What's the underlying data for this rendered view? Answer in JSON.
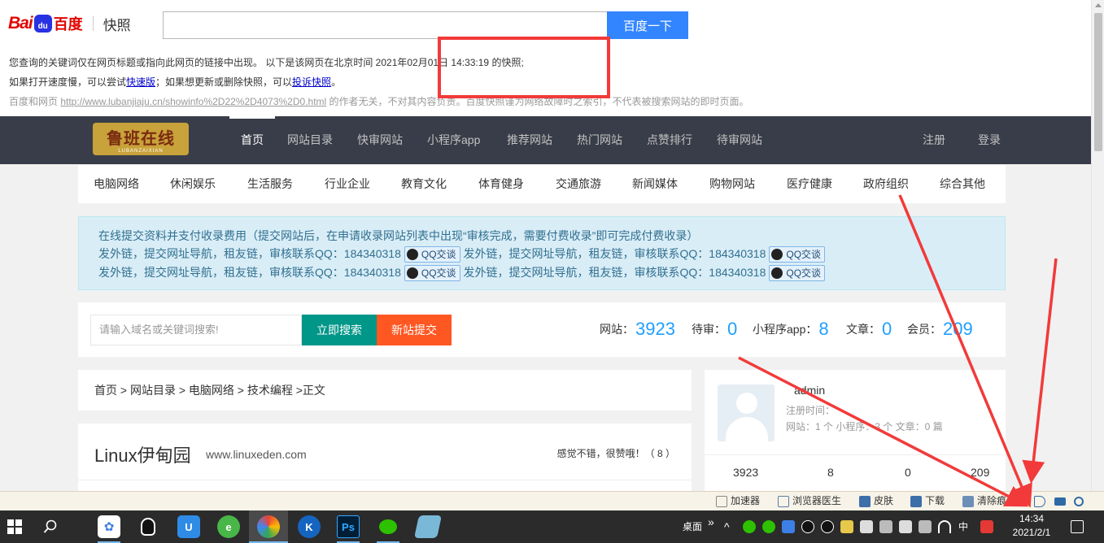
{
  "baidu": {
    "logo_bai": "Bai",
    "logo_du": "du",
    "logo_cn": "百度",
    "logo_kz": "快照",
    "search_button": "百度一下",
    "search_value": "",
    "line1": "您查询的关键词仅在网页标题或指向此网页的链接中出现。  以下是该网页在北京时间 2021年02月01日 14:33:19 的快照;",
    "line2_a": "如果打开速度慢，可以尝试",
    "line2_link1": "快速版",
    "line2_b": "；如果想更新或删除快照，可以",
    "line2_link2": "投诉快照",
    "line2_c": "。",
    "line3_a": "百度和网页 ",
    "line3_url": "http://www.lubanjiaju.cn/showinfo%2D22%2D4073%2D0.html",
    "line3_b": " 的作者无关，不对其内容负责。百度快照谨为网络故障时之索引，不代表被搜索网站的即时页面。"
  },
  "site": {
    "logo_text": "鲁班在线",
    "logo_sub": "LUBANZAIXIAN",
    "nav": [
      "首页",
      "网站目录",
      "快审网站",
      "小程序app",
      "推荐网站",
      "热门网站",
      "点赞排行",
      "待审网站"
    ],
    "nav_right": [
      "注册",
      "登录"
    ],
    "categories": [
      "电脑网络",
      "休闲娱乐",
      "生活服务",
      "行业企业",
      "教育文化",
      "体育健身",
      "交通旅游",
      "新闻媒体",
      "购物网站",
      "医疗健康",
      "政府组织",
      "综合其他"
    ],
    "notice": {
      "line1": "在线提交资料并支付收录费用（提交网站后，在申请收录网站列表中出现“审核完成，需要付费收录”即可完成付费收录）",
      "ad": "发外链，提交网址导航，租友链，审核联系QQ：184340318",
      "qq_button": "QQ交谈"
    },
    "search_placeholder": "请输入域名或关键词搜索!",
    "search_button": "立即搜索",
    "submit_button": "新站提交",
    "stats": [
      {
        "label": "网站：",
        "value": "3923"
      },
      {
        "label": "待审：",
        "value": "0"
      },
      {
        "label": "小程序app：",
        "value": "8"
      },
      {
        "label": "文章：",
        "value": "0"
      },
      {
        "label": "会员：",
        "value": "209"
      }
    ],
    "breadcrumb": "首页 > 网站目录 > 电脑网络 > 技术编程 >正文",
    "article_title": "Linux伊甸园",
    "article_domain": "www.linuxeden.com",
    "article_like": "感觉不错，很赞哦！（  8 ）",
    "user": {
      "name": "admin",
      "reg": "注册时间：",
      "counts": "网站：1 个   小程序：3 个   文章：0 篇",
      "stats": [
        "3923",
        "8",
        "0",
        "209"
      ]
    }
  },
  "statusbar": [
    "加速器",
    "浏览器医生",
    "皮肤",
    "下载",
    "清除痕迹"
  ],
  "taskbar": {
    "desktop_label": "桌面",
    "ime": "中",
    "time": "14:34",
    "date": "2021/2/1"
  },
  "colors": {
    "annotation_red": "#f23a3a",
    "baidu_blue": "#3385ff",
    "nav_bg": "#393d49",
    "accent_blue": "#1e9fff",
    "search_green": "#009688",
    "submit_orange": "#ff5722"
  }
}
